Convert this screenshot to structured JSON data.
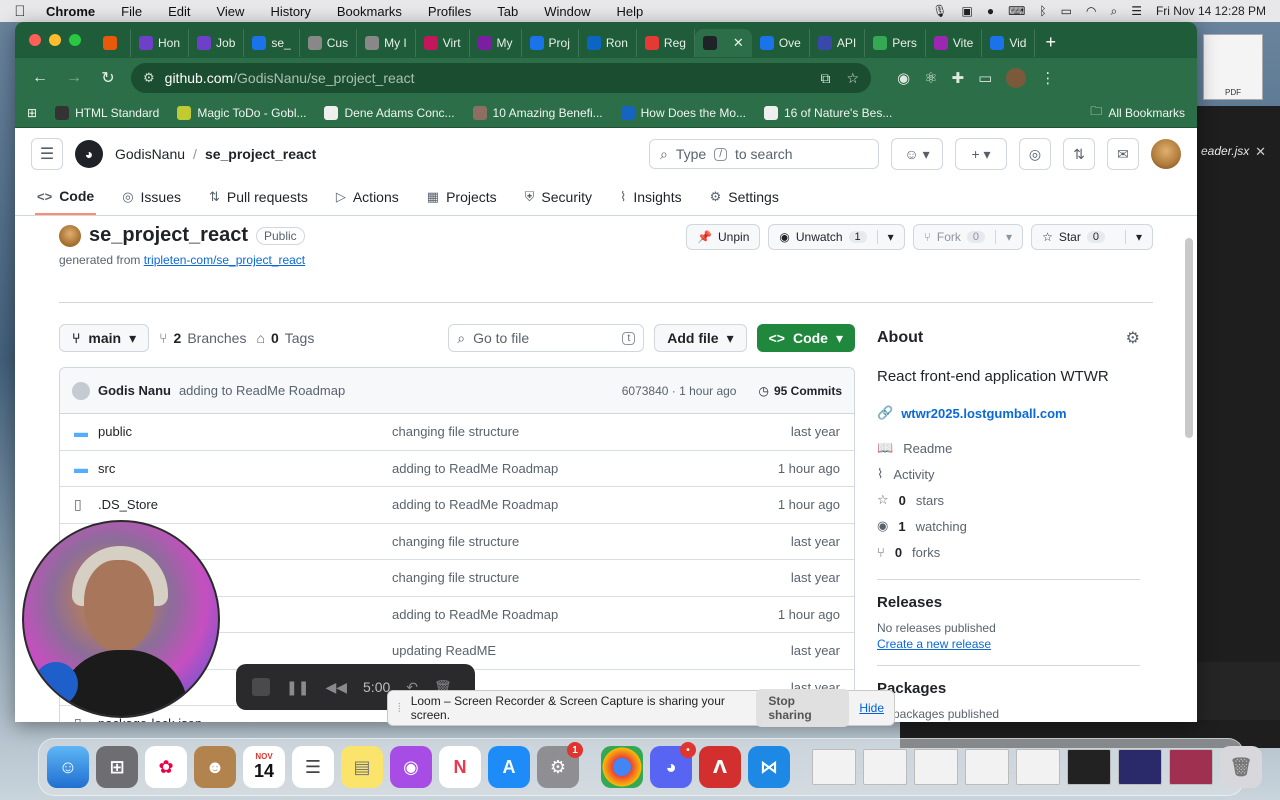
{
  "menubar": {
    "app": "Chrome",
    "items": [
      "File",
      "Edit",
      "View",
      "History",
      "Bookmarks",
      "Profiles",
      "Tab",
      "Window",
      "Help"
    ],
    "datetime": "Fri Nov 14  12:28 PM"
  },
  "tabs": [
    {
      "label": "",
      "color": "#e8590c"
    },
    {
      "label": "Hon",
      "color": "#6e40c9"
    },
    {
      "label": "Job",
      "color": "#6e40c9"
    },
    {
      "label": "se_",
      "color": "#1a73e8"
    },
    {
      "label": "Cus",
      "color": "#888888"
    },
    {
      "label": "My I",
      "color": "#888888"
    },
    {
      "label": "Virt",
      "color": "#c2185b"
    },
    {
      "label": "My",
      "color": "#7b1fa2"
    },
    {
      "label": "Proj",
      "color": "#1a73e8"
    },
    {
      "label": "Ron",
      "color": "#0a66c2"
    },
    {
      "label": "Reg",
      "color": "#e53935"
    },
    {
      "label": "",
      "color": "#1f2328",
      "active": true
    },
    {
      "label": "Ove",
      "color": "#1a73e8"
    },
    {
      "label": "API",
      "color": "#3949ab"
    },
    {
      "label": "Pers",
      "color": "#34a853"
    },
    {
      "label": "Vite",
      "color": "#9c27b0"
    },
    {
      "label": "Vid",
      "color": "#1a73e8"
    }
  ],
  "omnibox": {
    "host": "github.com",
    "path": "/GodisNanu/se_project_react"
  },
  "bookmarks": [
    {
      "label": "HTML Standard",
      "color": "#333333"
    },
    {
      "label": "Magic ToDo - Gobl...",
      "color": "#c0ca33"
    },
    {
      "label": "Dene Adams Conc...",
      "color": "#eeeeee"
    },
    {
      "label": "10 Amazing Benefi...",
      "color": "#8d6e63"
    },
    {
      "label": "How Does the Mo...",
      "color": "#1565c0"
    },
    {
      "label": "16 of Nature's Bes...",
      "color": "#eeeeee"
    }
  ],
  "all_bookmarks": "All Bookmarks",
  "gh": {
    "owner": "GodisNanu",
    "repo": "se_project_react",
    "search_prefix": "Type",
    "search_key": "/",
    "search_suffix": "to search",
    "nav": [
      {
        "label": "Code",
        "icon": "<>",
        "active": true
      },
      {
        "label": "Issues",
        "icon": "◎"
      },
      {
        "label": "Pull requests",
        "icon": "⇅"
      },
      {
        "label": "Actions",
        "icon": "▷"
      },
      {
        "label": "Projects",
        "icon": "▦"
      },
      {
        "label": "Security",
        "icon": "⛨"
      },
      {
        "label": "Insights",
        "icon": "⌇"
      },
      {
        "label": "Settings",
        "icon": "⚙"
      }
    ],
    "visibility": "Public",
    "generated_prefix": "generated from ",
    "generated_link": "tripleten-com/se_project_react",
    "actions": {
      "unpin": "Unpin",
      "unwatch": "Unwatch",
      "watch_count": "1",
      "fork": "Fork",
      "fork_count": "0",
      "star": "Star",
      "star_count": "0"
    },
    "branch": "main",
    "branches_count": "2",
    "branches_label": "Branches",
    "tags_count": "0",
    "tags_label": "Tags",
    "goto_placeholder": "Go to file",
    "goto_key": "t",
    "add_file": "Add file",
    "code_btn": "Code",
    "commit": {
      "author": "Godis Nanu",
      "message": "adding to ReadMe Roadmap",
      "hash_time": "6073840 · 1 hour ago",
      "count": "95 Commits"
    },
    "files": [
      {
        "name": "public",
        "type": "folder",
        "msg": "changing file structure",
        "date": "last year"
      },
      {
        "name": "src",
        "type": "folder",
        "msg": "adding to ReadMe Roadmap",
        "date": "1 hour ago"
      },
      {
        "name": ".DS_Store",
        "type": "file",
        "msg": "adding to ReadMe Roadmap",
        "date": "1 hour ago"
      },
      {
        "name": "",
        "type": "file",
        "msg": "changing file structure",
        "date": "last year"
      },
      {
        "name": "",
        "type": "file",
        "msg": "changing file structure",
        "date": "last year"
      },
      {
        "name": "",
        "type": "file",
        "msg": "adding to ReadMe Roadmap",
        "date": "1 hour ago"
      },
      {
        "name": "",
        "type": "file",
        "msg": "updating ReadME",
        "date": "last year"
      },
      {
        "name": "",
        "type": "file",
        "msg": "structure",
        "date": "last year"
      },
      {
        "name": "package-lock.json",
        "type": "file",
        "msg": "",
        "date": ""
      }
    ],
    "about": {
      "title": "About",
      "description": "React front-end application WTWR",
      "website": "wtwr2025.lostgumball.com",
      "readme": "Readme",
      "activity": "Activity",
      "stars_count": "0",
      "stars_label": "stars",
      "watching_count": "1",
      "watching_label": "watching",
      "forks_count": "0",
      "forks_label": "forks",
      "releases_title": "Releases",
      "releases_none": "No releases published",
      "releases_create": "Create a new release",
      "packages_title": "Packages",
      "packages_none": "packages published"
    }
  },
  "editor_tab": "eader.jsx",
  "pdf_label": "PDF",
  "loom": {
    "time": "5:00",
    "share_text": "Loom – Screen Recorder & Screen Capture is sharing your screen.",
    "stop": "Stop sharing",
    "hide": "Hide"
  },
  "dock": {
    "cal_month": "NOV",
    "cal_day": "14"
  }
}
